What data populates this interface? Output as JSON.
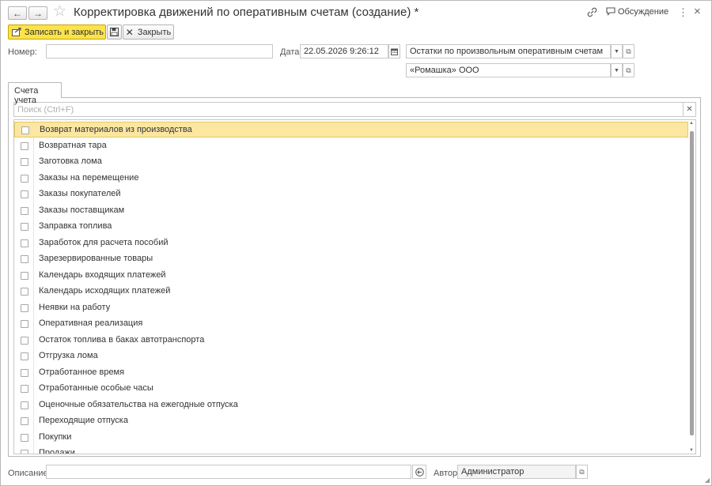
{
  "window": {
    "title": "Корректировка движений по оперативным счетам (создание) *",
    "discussion_label": "Обсуждение",
    "back_glyph": "←",
    "forward_glyph": "→",
    "more_glyph": "⋮",
    "close_glyph": "×"
  },
  "toolbar": {
    "save_close_label": "Записать и закрыть",
    "close_label": "Закрыть"
  },
  "form": {
    "number_label": "Номер:",
    "number_value": "",
    "date_label": "Дата:",
    "date_value": "22.05.2026  9:26:12",
    "register_value": "Остатки по произвольным оперативным счетам",
    "organization_value": "«Ромашка» ООО",
    "description_label": "Описание:",
    "description_value": "",
    "author_label": "Автор:",
    "author_value": "Администратор"
  },
  "tabs": [
    {
      "label": "Счета учета"
    }
  ],
  "search": {
    "placeholder": "Поиск (Ctrl+F)"
  },
  "accounts": [
    {
      "label": "Возврат материалов из производства",
      "checked": false,
      "selected": true
    },
    {
      "label": "Возвратная тара",
      "checked": false
    },
    {
      "label": "Заготовка лома",
      "checked": false
    },
    {
      "label": "Заказы на перемещение",
      "checked": false
    },
    {
      "label": "Заказы покупателей",
      "checked": false
    },
    {
      "label": "Заказы поставщикам",
      "checked": false
    },
    {
      "label": "Заправка топлива",
      "checked": false
    },
    {
      "label": "Заработок для расчета пособий",
      "checked": false
    },
    {
      "label": "Зарезервированные товары",
      "checked": false
    },
    {
      "label": "Календарь входящих платежей",
      "checked": false
    },
    {
      "label": "Календарь исходящих платежей",
      "checked": false
    },
    {
      "label": "Неявки на работу",
      "checked": false
    },
    {
      "label": "Оперативная реализация",
      "checked": false
    },
    {
      "label": "Остаток топлива в баках автотранспорта",
      "checked": false
    },
    {
      "label": "Отгрузка лома",
      "checked": false
    },
    {
      "label": "Отработанное время",
      "checked": false
    },
    {
      "label": "Отработанные особые часы",
      "checked": false
    },
    {
      "label": "Оценочные обязательства на ежегодные отпуска",
      "checked": false
    },
    {
      "label": "Переходящие отпуска",
      "checked": false
    },
    {
      "label": "Покупки",
      "checked": false
    },
    {
      "label": "Продажи",
      "checked": false
    }
  ],
  "colors": {
    "primary_button": "#fce34a",
    "selected_row": "#fbe7a2"
  }
}
